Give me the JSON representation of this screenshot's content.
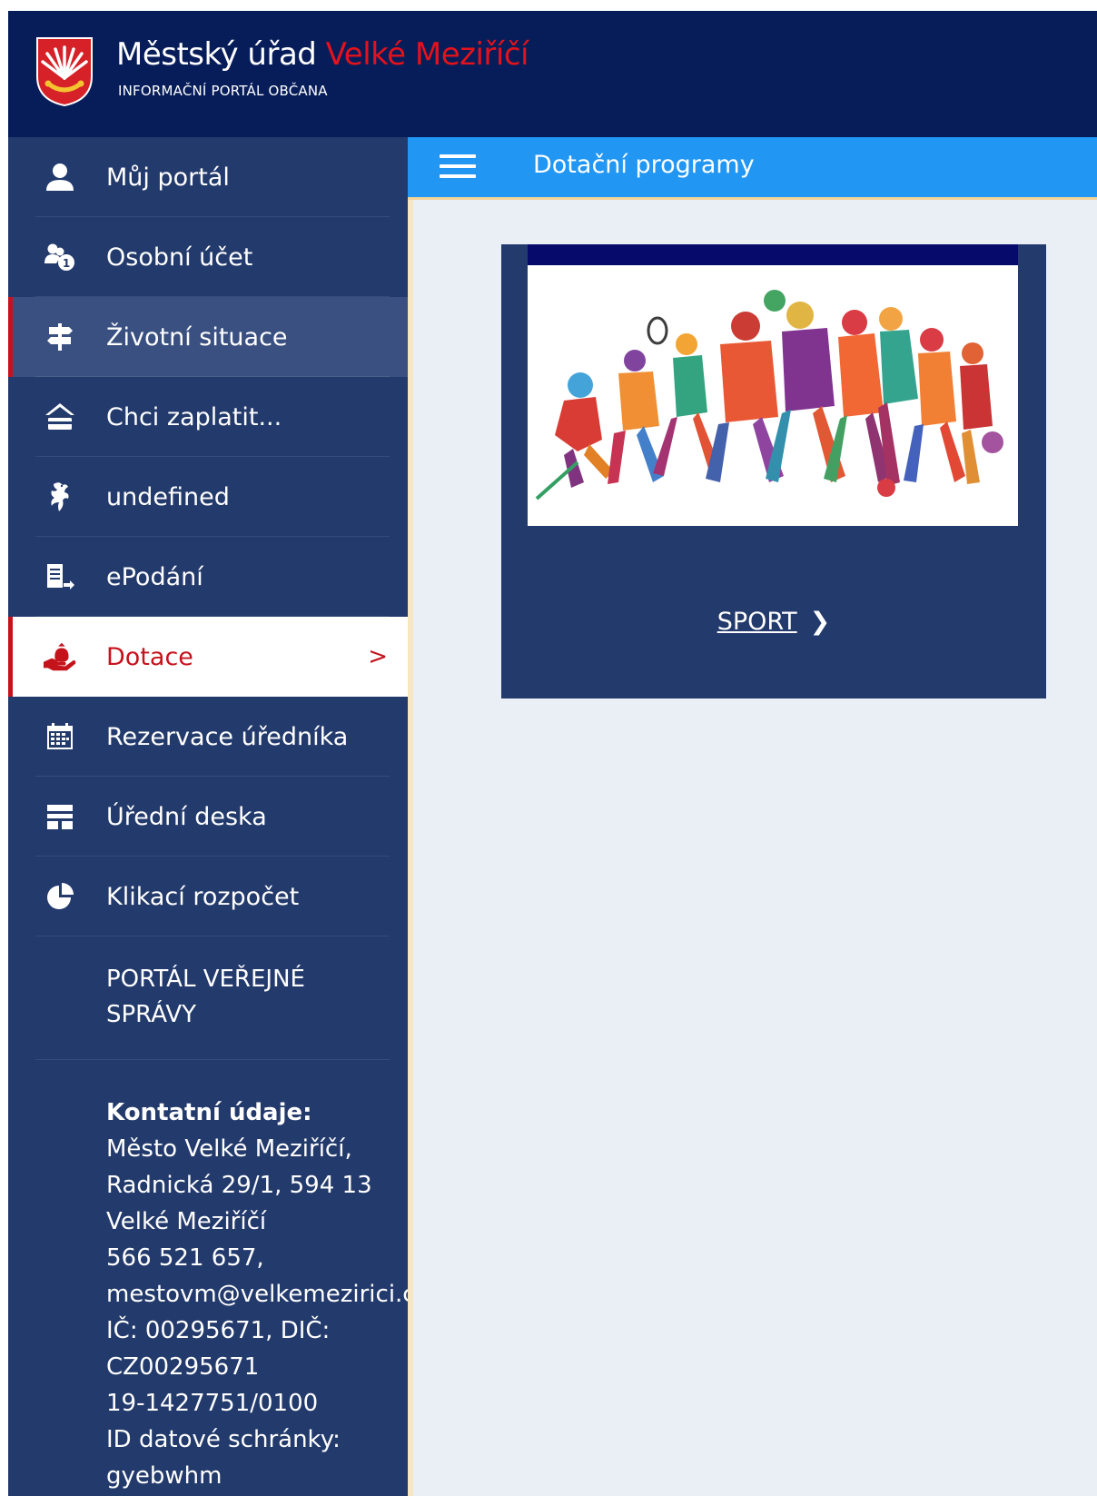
{
  "header": {
    "title_main": "Městský úřad ",
    "title_accent": "Velké Meziříčí",
    "subtitle": "INFORMAČNÍ PORTÁL OBČANA",
    "logo_icon": "city-coat-of-arms",
    "colors": {
      "header_bg": "#071d5a",
      "accent": "#e3121b"
    }
  },
  "sidebar": {
    "items": [
      {
        "label": "Můj portál",
        "icon": "user-icon"
      },
      {
        "label": "Osobní účet",
        "icon": "users-coin-icon"
      },
      {
        "label": "Životní situace",
        "icon": "signpost-icon",
        "state": "hover"
      },
      {
        "label": "Chci zaplatit...",
        "icon": "payment-icon"
      },
      {
        "label": "undefined",
        "icon": "lion-emblem-icon"
      },
      {
        "label": "ePodání",
        "icon": "document-send-icon"
      },
      {
        "label": "Dotace",
        "icon": "hand-money-bag-icon",
        "state": "active"
      },
      {
        "label": "Rezervace úředníka",
        "icon": "calendar-icon"
      },
      {
        "label": "Úřední deska",
        "icon": "board-icon"
      },
      {
        "label": "Klikací rozpočet",
        "icon": "pie-chart-icon"
      }
    ],
    "active_chevron": ">",
    "portal_link": "PORTÁL VEŘEJNÉ SPRÁVY",
    "contact": {
      "heading": "Kontatní údaje:",
      "lines": [
        "Město Velké Meziříčí,",
        "Radnická 29/1, 594 13",
        "Velké Meziříčí",
        "566 521 657,",
        "mestovm@velkemezirici.c",
        "IČ: 00295671, DIČ:",
        "CZ00295671",
        "19-1427751/0100",
        "ID datové schránky:",
        "gyebwhm"
      ]
    },
    "colors": {
      "bg": "#233a6c",
      "active": "#c5131c"
    }
  },
  "topbar": {
    "menu_icon": "hamburger-icon",
    "title": "Dotační programy",
    "color": "#2196f3"
  },
  "main": {
    "cards": [
      {
        "image": "sports-illustration",
        "link_label": "SPORT",
        "chevron": "❯"
      }
    ]
  }
}
